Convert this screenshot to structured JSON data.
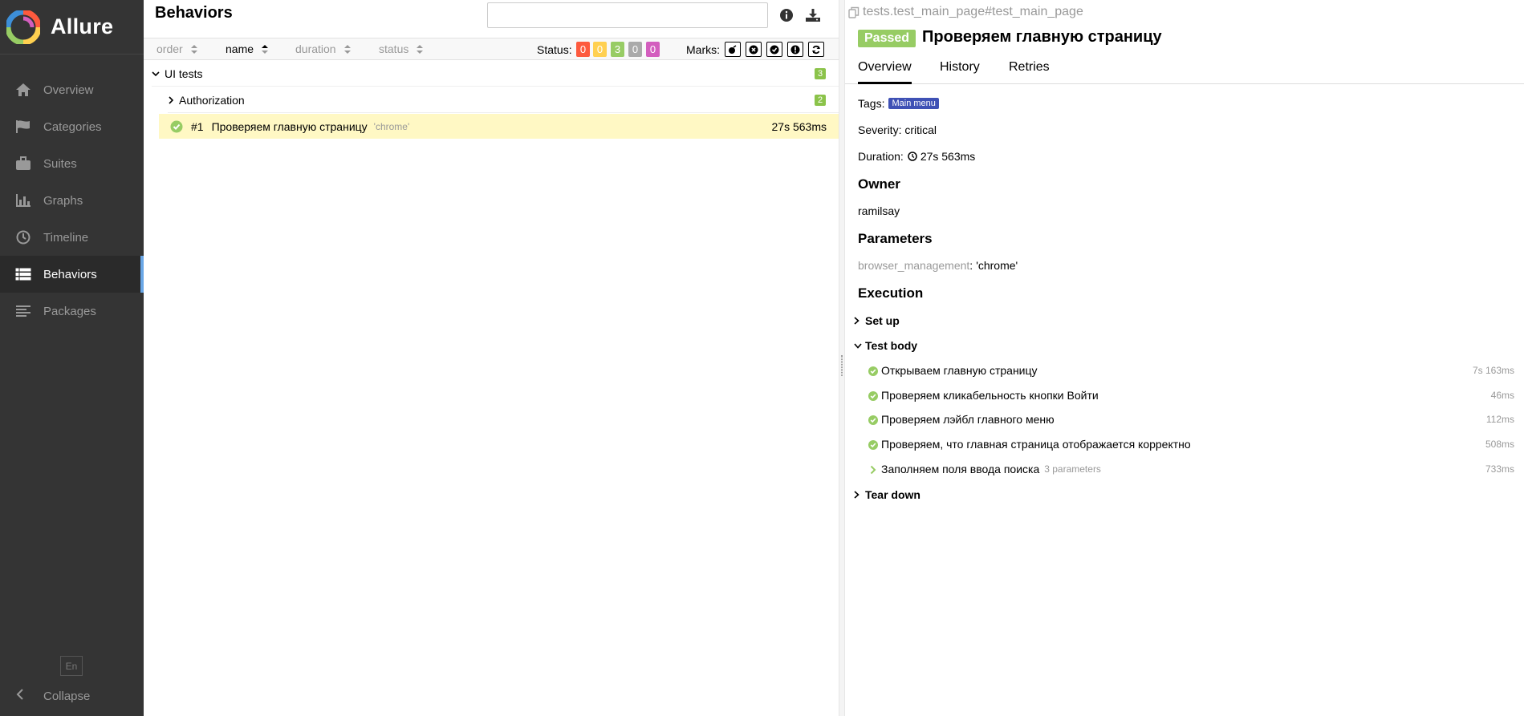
{
  "app": {
    "name": "Allure"
  },
  "sidebar": {
    "items": [
      {
        "label": "Overview",
        "icon": "home-icon"
      },
      {
        "label": "Categories",
        "icon": "flag-icon"
      },
      {
        "label": "Suites",
        "icon": "briefcase-icon"
      },
      {
        "label": "Graphs",
        "icon": "bar-chart-icon"
      },
      {
        "label": "Timeline",
        "icon": "clock-icon"
      },
      {
        "label": "Behaviors",
        "icon": "list-icon",
        "active": true
      },
      {
        "label": "Packages",
        "icon": "align-left-icon"
      }
    ],
    "language": "En",
    "collapse_label": "Collapse"
  },
  "behaviors": {
    "title": "Behaviors",
    "search": {
      "value": "",
      "placeholder": ""
    },
    "sort": {
      "order": "order",
      "name": "name",
      "duration": "duration",
      "status": "status"
    },
    "status_label": "Status:",
    "status_counts": [
      {
        "value": "0",
        "color": "#fd5a3e"
      },
      {
        "value": "0",
        "color": "#ffd050"
      },
      {
        "value": "3",
        "color": "#97cc64"
      },
      {
        "value": "0",
        "color": "#aaaaaa"
      },
      {
        "value": "0",
        "color": "#d35ebe"
      }
    ],
    "marks_label": "Marks:",
    "tree": {
      "group": {
        "label": "UI tests",
        "count": "3"
      },
      "subgroup": {
        "label": "Authorization",
        "count": "2"
      },
      "test": {
        "number": "#1",
        "name": "Проверяем главную страницу",
        "param": "'chrome'",
        "duration": "27s 563ms"
      }
    }
  },
  "test_detail": {
    "path": "tests.test_main_page#test_main_page",
    "status": "Passed",
    "title": "Проверяем главную страницу",
    "tabs": [
      "Overview",
      "History",
      "Retries"
    ],
    "tags_label": "Tags:",
    "tag": "Main menu",
    "severity": "Severity: critical",
    "duration_label": "Duration:",
    "duration": "27s 563ms",
    "owner_heading": "Owner",
    "owner": "ramilsay",
    "parameters_heading": "Parameters",
    "parameter": {
      "name": "browser_management",
      "value": "'chrome'"
    },
    "execution_heading": "Execution",
    "setup_label": "Set up",
    "body_label": "Test body",
    "teardown_label": "Tear down",
    "steps": [
      {
        "name": "Открываем главную страницу",
        "duration": "7s 163ms"
      },
      {
        "name": "Проверяем кликабельность кнопки Войти",
        "duration": "46ms"
      },
      {
        "name": "Проверяем лэйбл главного меню",
        "duration": "112ms"
      },
      {
        "name": "Проверяем, что главная страница отображается корректно",
        "duration": "508ms"
      },
      {
        "name": "Заполняем поля ввода поиска",
        "params": "3 parameters",
        "duration": "733ms"
      }
    ]
  }
}
